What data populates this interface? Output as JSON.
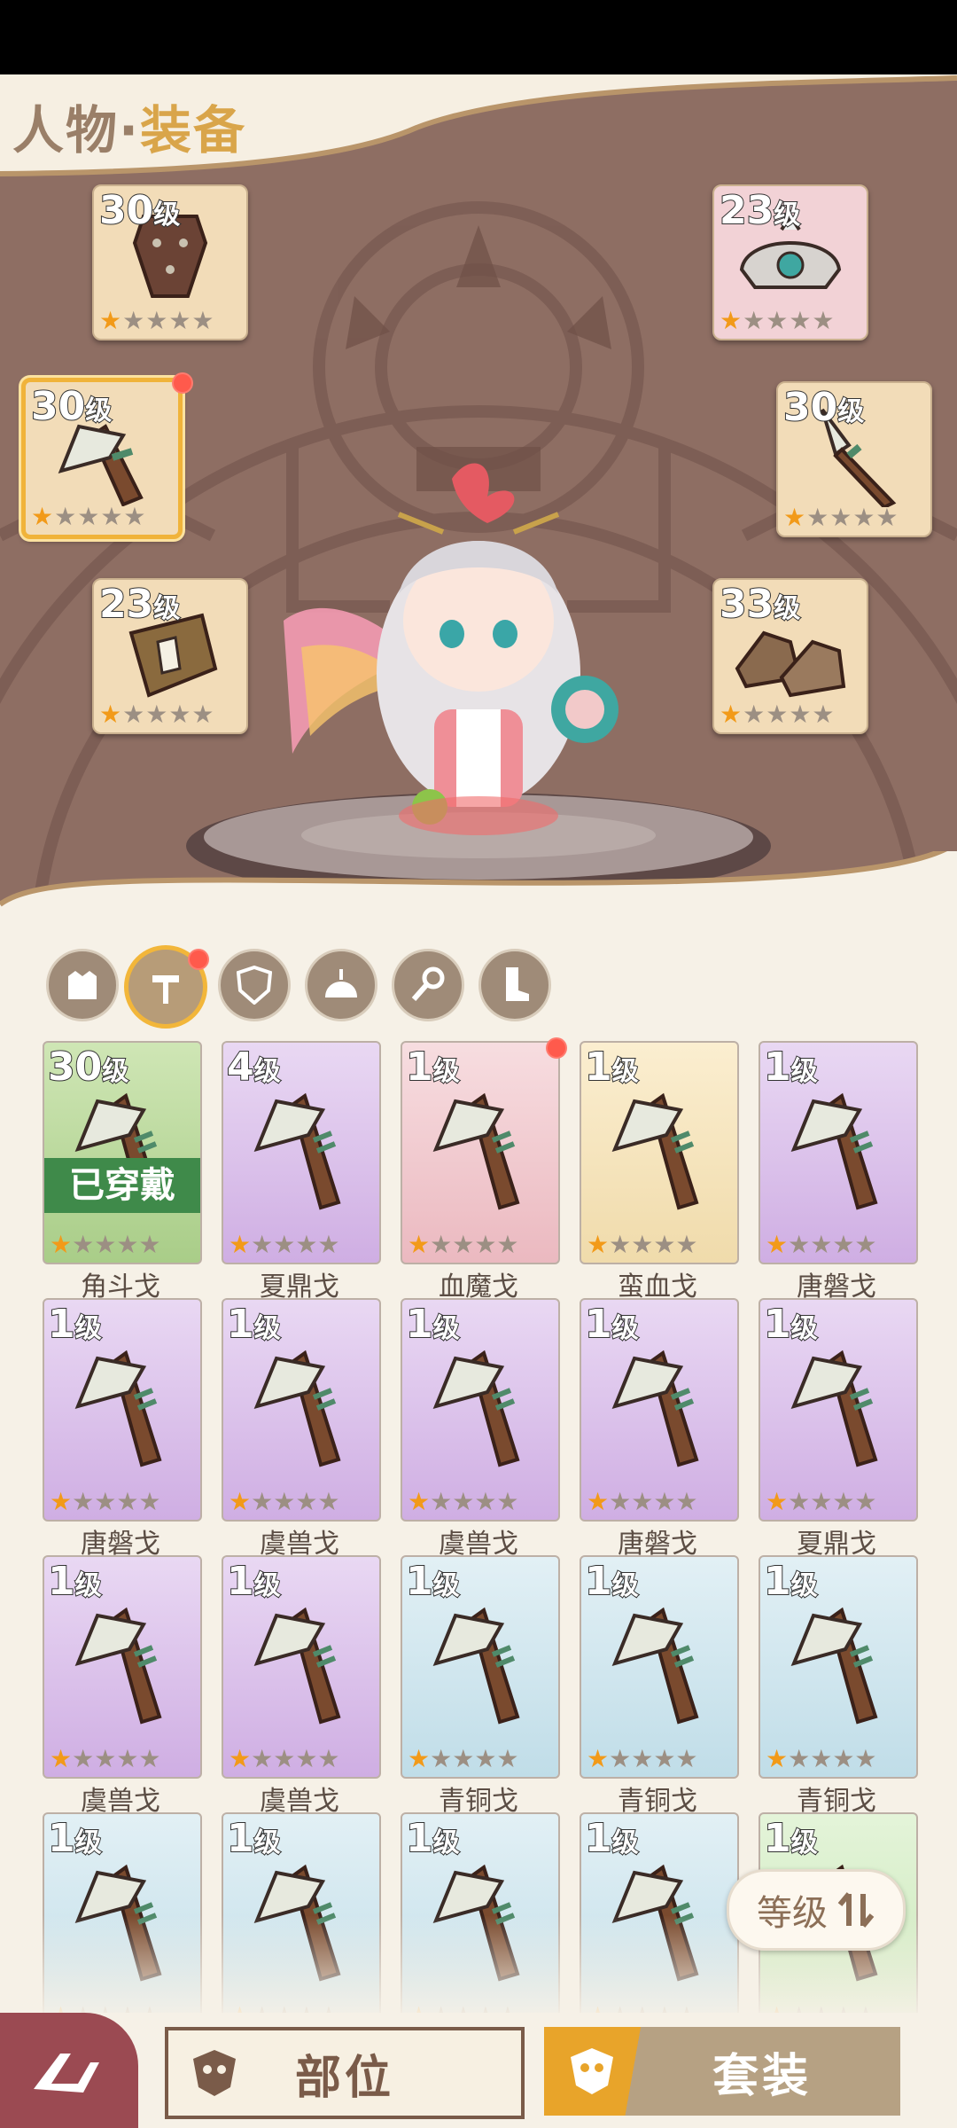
{
  "page": {
    "title_prefix": "人物·",
    "title_main": "装备"
  },
  "equipped_slots": [
    {
      "level": "30",
      "unit": "级",
      "stars_on": 1,
      "stars_total": 5,
      "icon": "leather-armor-icon",
      "selected": false
    },
    {
      "level": "23",
      "unit": "级",
      "stars_on": 1,
      "stars_total": 5,
      "icon": "helmet-icon",
      "selected": false
    },
    {
      "level": "30",
      "unit": "级",
      "stars_on": 1,
      "stars_total": 5,
      "icon": "stone-axe-icon",
      "selected": true,
      "notify": true
    },
    {
      "level": "30",
      "unit": "级",
      "stars_on": 1,
      "stars_total": 5,
      "icon": "spear-icon",
      "selected": false
    },
    {
      "level": "23",
      "unit": "级",
      "stars_on": 1,
      "stars_total": 5,
      "icon": "shield-icon",
      "selected": false
    },
    {
      "level": "33",
      "unit": "级",
      "stars_on": 1,
      "stars_total": 5,
      "icon": "boots-icon",
      "selected": false
    }
  ],
  "category_tabs": [
    {
      "icon": "armor-icon",
      "active": false
    },
    {
      "icon": "weapon-icon",
      "active": true,
      "notify": true
    },
    {
      "icon": "shield-icon",
      "active": false
    },
    {
      "icon": "helmet-icon",
      "active": false
    },
    {
      "icon": "accessory-icon",
      "active": false
    },
    {
      "icon": "boots-icon",
      "active": false
    }
  ],
  "inventory": [
    {
      "level": "30",
      "unit": "级",
      "name": "角斗戈",
      "rarity": "green",
      "equipped_label": "已穿戴"
    },
    {
      "level": "4",
      "unit": "级",
      "name": "夏鼎戈",
      "rarity": "purple"
    },
    {
      "level": "1",
      "unit": "级",
      "name": "血魔戈",
      "rarity": "pink",
      "notify": true
    },
    {
      "level": "1",
      "unit": "级",
      "name": "蛮血戈",
      "rarity": "yellow"
    },
    {
      "level": "1",
      "unit": "级",
      "name": "唐磐戈",
      "rarity": "purple"
    },
    {
      "level": "1",
      "unit": "级",
      "name": "唐磐戈",
      "rarity": "purple"
    },
    {
      "level": "1",
      "unit": "级",
      "name": "虞兽戈",
      "rarity": "purple"
    },
    {
      "level": "1",
      "unit": "级",
      "name": "虞兽戈",
      "rarity": "purple"
    },
    {
      "level": "1",
      "unit": "级",
      "name": "唐磐戈",
      "rarity": "purple"
    },
    {
      "level": "1",
      "unit": "级",
      "name": "夏鼎戈",
      "rarity": "purple"
    },
    {
      "level": "1",
      "unit": "级",
      "name": "虞兽戈",
      "rarity": "purple"
    },
    {
      "level": "1",
      "unit": "级",
      "name": "虞兽戈",
      "rarity": "purple"
    },
    {
      "level": "1",
      "unit": "级",
      "name": "青铜戈",
      "rarity": "blue"
    },
    {
      "level": "1",
      "unit": "级",
      "name": "青铜戈",
      "rarity": "blue"
    },
    {
      "level": "1",
      "unit": "级",
      "name": "青铜戈",
      "rarity": "blue"
    },
    {
      "level": "1",
      "unit": "级",
      "rarity": "blue"
    },
    {
      "level": "1",
      "unit": "级",
      "rarity": "blue"
    },
    {
      "level": "1",
      "unit": "级",
      "rarity": "blue"
    },
    {
      "level": "1",
      "unit": "级",
      "rarity": "blue"
    },
    {
      "level": "1",
      "unit": "级",
      "rarity": "lightgreen"
    }
  ],
  "sort_button": {
    "label": "等级"
  },
  "bottom_nav": {
    "part_label": "部位",
    "set_label": "套装"
  },
  "colors": {
    "accent": "#e8a42a",
    "scene_bg": "#8c6b62",
    "panel_bg": "#f6f1e7",
    "star_on": "#f29a19",
    "equipped_green": "#3f8a4a"
  }
}
